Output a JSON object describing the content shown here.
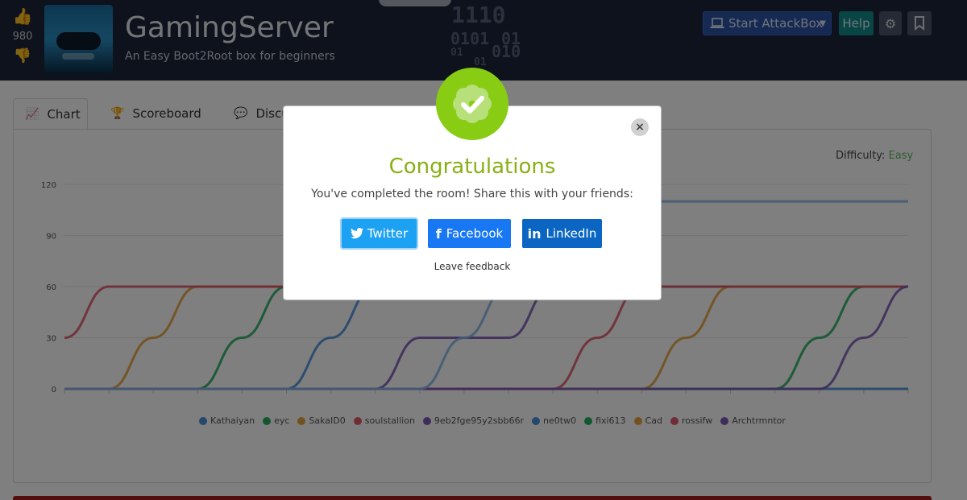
{
  "header": {
    "votes": "980",
    "title": "GamingServer",
    "subtitle": "An Easy Boot2Root box for beginners",
    "binary": [
      "1110",
      "0101",
      "01",
      "01",
      "010",
      "01"
    ],
    "attackbox_label": "Start AttackBox",
    "help_label": "Help"
  },
  "tabs": [
    {
      "label": "Chart"
    },
    {
      "label": "Scoreboard"
    },
    {
      "label": "Discu"
    }
  ],
  "difficulty": {
    "label": "Difficulty:",
    "value": "Easy"
  },
  "chart_data": {
    "type": "line",
    "y_ticks": [
      0,
      30,
      60,
      90,
      120
    ],
    "ylim": [
      0,
      120
    ],
    "x_count": 20,
    "series": [
      {
        "name": "Kathaiyan",
        "color": "#4a90d9",
        "values": [
          0,
          0,
          0,
          0,
          0,
          0,
          0,
          0,
          0,
          0,
          0,
          0,
          0,
          0,
          0,
          0,
          0,
          0,
          0,
          0
        ]
      },
      {
        "name": "eyc",
        "color": "#27ae60",
        "values": [
          0,
          0,
          0,
          0,
          30,
          60,
          60,
          60,
          60,
          60,
          60,
          60,
          60,
          60,
          60,
          60,
          60,
          60,
          60,
          60
        ]
      },
      {
        "name": "SakaID0",
        "color": "#e6a23c",
        "values": [
          0,
          0,
          30,
          60,
          60,
          60,
          60,
          60,
          60,
          60,
          60,
          60,
          60,
          60,
          60,
          60,
          60,
          60,
          60,
          60
        ]
      },
      {
        "name": "soulstallion",
        "color": "#e05a6a",
        "values": [
          30,
          60,
          60,
          60,
          60,
          60,
          60,
          60,
          60,
          60,
          60,
          60,
          60,
          60,
          60,
          60,
          60,
          60,
          60,
          60
        ]
      },
      {
        "name": "9eb2fge95y2sbb66r",
        "color": "#7d5ab6",
        "values": [
          0,
          0,
          0,
          0,
          0,
          0,
          0,
          0,
          30,
          30,
          30,
          60,
          60,
          60,
          60,
          60,
          60,
          60,
          60,
          60
        ]
      },
      {
        "name": "ne0tw0",
        "color": "#4a90d9",
        "values": [
          0,
          0,
          0,
          0,
          0,
          0,
          30,
          60,
          60,
          60,
          60,
          60,
          60,
          60,
          60,
          60,
          60,
          60,
          60,
          60
        ]
      },
      {
        "name": "fixi613",
        "color": "#27ae60",
        "values": [
          0,
          0,
          0,
          0,
          0,
          0,
          0,
          0,
          0,
          0,
          0,
          0,
          0,
          0,
          0,
          0,
          0,
          30,
          60,
          60
        ]
      },
      {
        "name": "Cad",
        "color": "#e6a23c",
        "values": [
          0,
          0,
          0,
          0,
          0,
          0,
          0,
          0,
          0,
          0,
          0,
          0,
          0,
          0,
          30,
          60,
          60,
          60,
          60,
          60
        ]
      },
      {
        "name": "rossifw",
        "color": "#e05a6a",
        "values": [
          0,
          0,
          0,
          0,
          0,
          0,
          0,
          0,
          0,
          0,
          0,
          0,
          30,
          60,
          60,
          60,
          60,
          60,
          60,
          60
        ]
      },
      {
        "name": "Archtrmntor",
        "color": "#7d5ab6",
        "values": [
          0,
          0,
          0,
          0,
          0,
          0,
          0,
          0,
          0,
          0,
          0,
          0,
          0,
          0,
          0,
          0,
          0,
          0,
          30,
          60
        ]
      },
      {
        "name": "",
        "color": "#86b7e8",
        "values": [
          0,
          0,
          0,
          0,
          0,
          0,
          0,
          0,
          0,
          30,
          60,
          90,
          110,
          110,
          110,
          110,
          110,
          110,
          110,
          110
        ]
      }
    ]
  },
  "modal": {
    "title": "Congratulations",
    "message": "You've completed the room! Share this with your friends:",
    "twitter_label": "Twitter",
    "facebook_label": "Facebook",
    "linkedin_label": "LinkedIn",
    "feedback_label": "Leave feedback",
    "close_symbol": "×"
  },
  "colors": {
    "header_bg": "#1c2538",
    "accent_green": "#88cc14",
    "twitter": "#1da1f2",
    "facebook": "#1877f2",
    "linkedin": "#0a66c2"
  }
}
